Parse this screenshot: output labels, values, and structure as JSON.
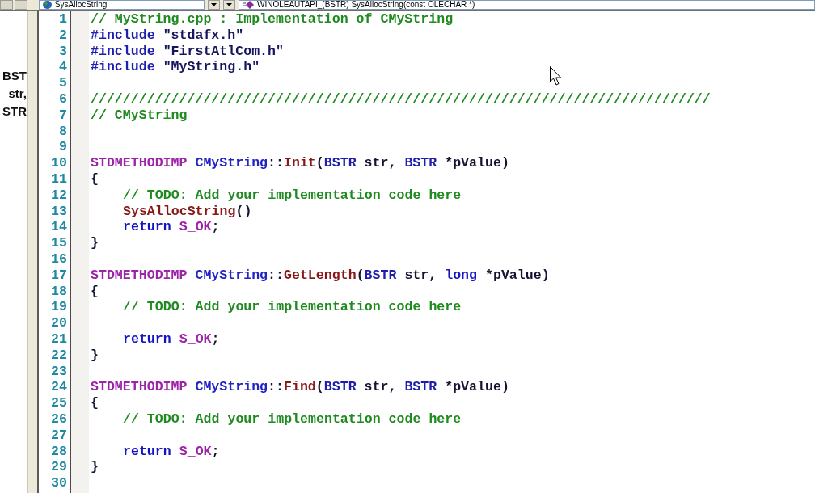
{
  "toolbar": {
    "class_combo": {
      "value": "SysAllocString"
    },
    "member_combo": {
      "value": "WINOLEAUTAPI_(BSTR) SysAllocString(const OLECHAR *)"
    }
  },
  "side_panel": {
    "items": [
      "BST",
      "str,",
      "STR"
    ]
  },
  "editor": {
    "lines": [
      {
        "number": "1",
        "code": {
          "indented": false,
          "tokens": [
            {
              "kind": "comment",
              "text": "// MyString.cpp : Implementation of CMyString"
            }
          ]
        }
      },
      {
        "number": "2",
        "code": {
          "indented": false,
          "tokens": [
            {
              "kind": "preprocessor",
              "text": "#include "
            },
            {
              "kind": "string",
              "text": "\"stdafx.h\""
            }
          ]
        }
      },
      {
        "number": "3",
        "code": {
          "indented": false,
          "tokens": [
            {
              "kind": "preprocessor",
              "text": "#include "
            },
            {
              "kind": "string",
              "text": "\"FirstAtlCom.h\""
            }
          ]
        }
      },
      {
        "number": "4",
        "code": {
          "indented": false,
          "tokens": [
            {
              "kind": "preprocessor",
              "text": "#include "
            },
            {
              "kind": "string",
              "text": "\"MyString.h\""
            }
          ]
        }
      },
      {
        "number": "5"
      },
      {
        "number": "6",
        "code": {
          "indented": false,
          "tokens": [
            {
              "kind": "comment",
              "text": "/////////////////////////////////////////////////////////////////////////////"
            }
          ]
        }
      },
      {
        "number": "7",
        "code": {
          "indented": false,
          "tokens": [
            {
              "kind": "comment",
              "text": "// CMyString"
            }
          ]
        }
      },
      {
        "number": "8"
      },
      {
        "number": "9"
      },
      {
        "number": "10",
        "code": {
          "indented": false,
          "tokens": [
            {
              "kind": "macro",
              "text": "STDMETHODIMP "
            },
            {
              "kind": "class",
              "text": "CMyString"
            },
            {
              "kind": "plain",
              "text": "::"
            },
            {
              "kind": "function",
              "text": "Init"
            },
            {
              "kind": "plain",
              "text": "("
            },
            {
              "kind": "type",
              "text": "BSTR"
            },
            {
              "kind": "plain",
              "text": " str, "
            },
            {
              "kind": "type",
              "text": "BSTR"
            },
            {
              "kind": "plain",
              "text": " *pValue)"
            }
          ]
        }
      },
      {
        "number": "11",
        "code": {
          "indented": false,
          "tokens": [
            {
              "kind": "plain",
              "text": "{"
            }
          ]
        }
      },
      {
        "number": "12",
        "code": {
          "indented": true,
          "tokens": [
            {
              "kind": "comment",
              "text": "// TODO: Add your implementation code here"
            }
          ]
        }
      },
      {
        "number": "13",
        "code": {
          "indented": true,
          "tokens": [
            {
              "kind": "function",
              "text": "SysAllocString"
            },
            {
              "kind": "plain",
              "text": "()"
            }
          ]
        }
      },
      {
        "number": "14",
        "code": {
          "indented": true,
          "tokens": [
            {
              "kind": "keyword",
              "text": "return "
            },
            {
              "kind": "macro",
              "text": "S_OK"
            },
            {
              "kind": "plain",
              "text": ";"
            }
          ]
        }
      },
      {
        "number": "15",
        "code": {
          "indented": false,
          "tokens": [
            {
              "kind": "plain",
              "text": "}"
            }
          ]
        }
      },
      {
        "number": "16"
      },
      {
        "number": "17",
        "code": {
          "indented": false,
          "tokens": [
            {
              "kind": "macro",
              "text": "STDMETHODIMP "
            },
            {
              "kind": "class",
              "text": "CMyString"
            },
            {
              "kind": "plain",
              "text": "::"
            },
            {
              "kind": "function",
              "text": "GetLength"
            },
            {
              "kind": "plain",
              "text": "("
            },
            {
              "kind": "type",
              "text": "BSTR"
            },
            {
              "kind": "plain",
              "text": " str, "
            },
            {
              "kind": "keyword",
              "text": "long"
            },
            {
              "kind": "plain",
              "text": " *pValue)"
            }
          ]
        }
      },
      {
        "number": "18",
        "code": {
          "indented": false,
          "tokens": [
            {
              "kind": "plain",
              "text": "{"
            }
          ]
        }
      },
      {
        "number": "19",
        "code": {
          "indented": true,
          "tokens": [
            {
              "kind": "comment",
              "text": "// TODO: Add your implementation code here"
            }
          ]
        }
      },
      {
        "number": "20"
      },
      {
        "number": "21",
        "code": {
          "indented": true,
          "tokens": [
            {
              "kind": "keyword",
              "text": "return "
            },
            {
              "kind": "macro",
              "text": "S_OK"
            },
            {
              "kind": "plain",
              "text": ";"
            }
          ]
        }
      },
      {
        "number": "22",
        "code": {
          "indented": false,
          "tokens": [
            {
              "kind": "plain",
              "text": "}"
            }
          ]
        }
      },
      {
        "number": "23"
      },
      {
        "number": "24",
        "code": {
          "indented": false,
          "tokens": [
            {
              "kind": "macro",
              "text": "STDMETHODIMP "
            },
            {
              "kind": "class",
              "text": "CMyString"
            },
            {
              "kind": "plain",
              "text": "::"
            },
            {
              "kind": "function",
              "text": "Find"
            },
            {
              "kind": "plain",
              "text": "("
            },
            {
              "kind": "type",
              "text": "BSTR"
            },
            {
              "kind": "plain",
              "text": " str, "
            },
            {
              "kind": "type",
              "text": "BSTR"
            },
            {
              "kind": "plain",
              "text": " *pValue)"
            }
          ]
        }
      },
      {
        "number": "25",
        "code": {
          "indented": false,
          "tokens": [
            {
              "kind": "plain",
              "text": "{"
            }
          ]
        }
      },
      {
        "number": "26",
        "code": {
          "indented": true,
          "tokens": [
            {
              "kind": "comment",
              "text": "// TODO: Add your implementation code here"
            }
          ]
        }
      },
      {
        "number": "27"
      },
      {
        "number": "28",
        "code": {
          "indented": true,
          "tokens": [
            {
              "kind": "keyword",
              "text": "return "
            },
            {
              "kind": "macro",
              "text": "S_OK"
            },
            {
              "kind": "plain",
              "text": ";"
            }
          ]
        }
      },
      {
        "number": "29",
        "code": {
          "indented": false,
          "tokens": [
            {
              "kind": "plain",
              "text": "}"
            }
          ]
        }
      },
      {
        "number": "30"
      }
    ]
  }
}
